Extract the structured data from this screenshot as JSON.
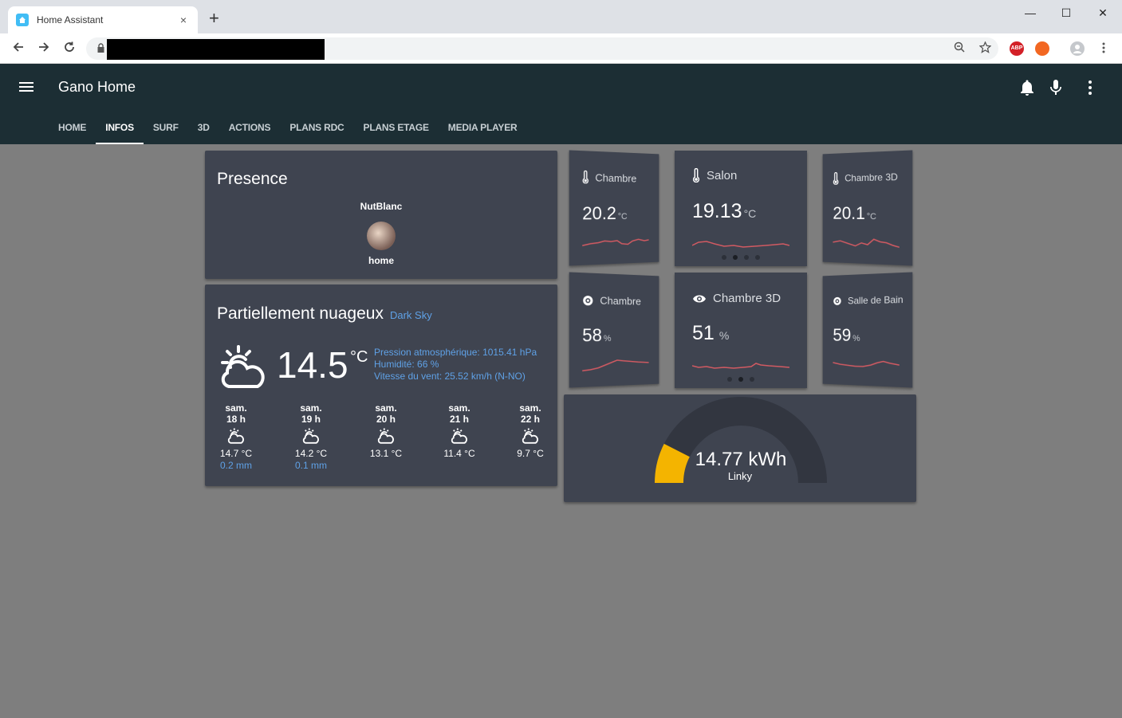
{
  "browser": {
    "tab_title": "Home Assistant",
    "tab_close": "×",
    "new_tab": "+",
    "window_controls": [
      "—",
      "☐",
      "✕"
    ],
    "extensions": [
      "ABP"
    ]
  },
  "header": {
    "title": "Gano Home",
    "tabs": [
      {
        "label": "HOME",
        "active": false
      },
      {
        "label": "INFOS",
        "active": true
      },
      {
        "label": "SURF",
        "active": false
      },
      {
        "label": "3D",
        "active": false
      },
      {
        "label": "ACTIONS",
        "active": false
      },
      {
        "label": "PLANS RDC",
        "active": false
      },
      {
        "label": "PLANS ETAGE",
        "active": false
      },
      {
        "label": "MEDIA PLAYER",
        "active": false
      }
    ],
    "icons": [
      "bell-icon",
      "microphone-icon",
      "more-vert-icon"
    ]
  },
  "presence": {
    "title": "Presence",
    "person_name": "NutBlanc",
    "state": "home"
  },
  "weather": {
    "condition": "Partiellement nuageux",
    "provider": "Dark Sky",
    "temperature": "14.5",
    "unit": "°C",
    "pressure": "Pression atmosphérique: 1015.41 hPa",
    "humidity": "Humidité: 66 %",
    "wind": "Vitesse du vent: 25.52 km/h (N-NO)",
    "forecast": [
      {
        "day": "sam.",
        "hour": "18 h",
        "temp": "14.7 °C",
        "precip": "0.2 mm"
      },
      {
        "day": "sam.",
        "hour": "19 h",
        "temp": "14.2 °C",
        "precip": "0.1 mm"
      },
      {
        "day": "sam.",
        "hour": "20 h",
        "temp": "13.1 °C",
        "precip": ""
      },
      {
        "day": "sam.",
        "hour": "21 h",
        "temp": "11.4 °C",
        "precip": ""
      },
      {
        "day": "sam.",
        "hour": "22 h",
        "temp": "9.7 °C",
        "precip": ""
      }
    ]
  },
  "sensors": [
    {
      "name": "Chambre",
      "value": "20.2",
      "unit": "°C",
      "icon": "thermometer-icon"
    },
    {
      "name": "Salon",
      "value": "19.13",
      "unit": "°C",
      "icon": "thermometer-icon"
    },
    {
      "name": "Chambre 3D",
      "value": "20.1",
      "unit": "°C",
      "icon": "thermometer-icon"
    },
    {
      "name": "Chambre",
      "value": "58",
      "unit": "%",
      "icon": "humidity-icon"
    },
    {
      "name": "Chambre 3D",
      "value": "51",
      "unit": "%",
      "icon": "humidity-icon"
    },
    {
      "name": "Salle de Bain",
      "value": "59",
      "unit": "%",
      "icon": "humidity-icon"
    }
  ],
  "gauge": {
    "value": "14.77 kWh",
    "name": "Linky",
    "fill_fraction": 0.15,
    "fill_color": "#f4b400"
  },
  "colors": {
    "header_bg": "#1c2e34",
    "card_bg": "#3f4450",
    "page_bg": "#7e7e7e",
    "accent_blue": "#5fa1e6",
    "sparkline": "#d15a62"
  }
}
